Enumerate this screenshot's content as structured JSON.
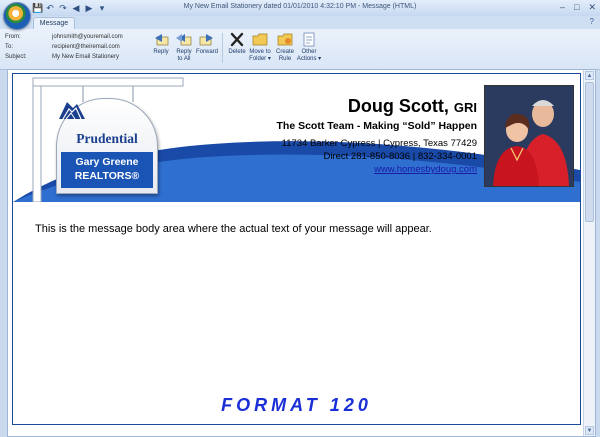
{
  "window": {
    "title": "My New Email Stationery  dated 01/01/2010  4:32:10 PM  -  Message (HTML)",
    "controls": [
      "–",
      "□",
      "✕"
    ]
  },
  "quick_access": [
    "💾",
    "↶",
    "↷",
    "◀",
    "▶",
    "▾"
  ],
  "tabs": [
    {
      "label": "Message"
    }
  ],
  "help_glyph": "?",
  "header": {
    "from_label": "From:",
    "to_label": "To:",
    "subject_label": "Subject:",
    "from_value": "johnsmith@youremail.com",
    "to_value": "recipient@theiremail.com",
    "subject_value": "My New Email Stationery"
  },
  "ribbon": {
    "reply": "Reply",
    "reply_all_1": "Reply",
    "reply_all_2": "to All",
    "forward": "Forward",
    "delete": "Delete",
    "move_1": "Move to",
    "move_2": "Folder ▾",
    "rule_1": "Create",
    "rule_2": "Rule",
    "other_1": "Other",
    "other_2": "Actions ▾"
  },
  "stationery": {
    "logo_name": "Prudential",
    "brokerage_1": "Gary Greene",
    "brokerage_2": "REALTORS®",
    "agent_name": "Doug Scott,",
    "agent_designation": "GRI",
    "team": "The Scott Team - Making “Sold” Happen",
    "address": "11734 Barker Cypress | Cypress, Texas 77429",
    "phone": "Direct 281-850-8036 | 832-334-0001",
    "website": "www.homesbydoug.com",
    "message": "This is the message body area where the actual text of your message will appear.",
    "format_label": "FORMAT 120"
  },
  "colors": {
    "brand_blue": "#1a55b5",
    "format_blue": "#1a2fd6",
    "link": "#1a1aa8"
  }
}
